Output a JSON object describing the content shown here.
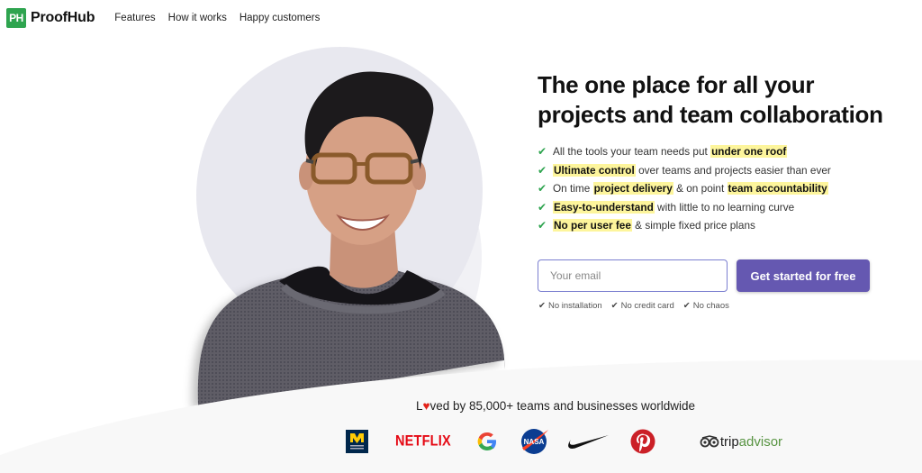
{
  "nav": {
    "logo_badge": "PH",
    "logo_text": "ProofHub",
    "links": [
      "Features",
      "How it works",
      "Happy customers"
    ]
  },
  "hero": {
    "title_line1": "The one place for all your",
    "title_line2": "projects and team collaboration",
    "features": [
      [
        {
          "t": "All the tools your team needs put ",
          "h": false
        },
        {
          "t": "under one roof",
          "h": true
        }
      ],
      [
        {
          "t": "Ultimate control",
          "h": true
        },
        {
          "t": " over teams and projects easier than ever",
          "h": false
        }
      ],
      [
        {
          "t": "On time ",
          "h": false
        },
        {
          "t": "project delivery",
          "h": true
        },
        {
          "t": " & on point ",
          "h": false
        },
        {
          "t": "team accountability",
          "h": true
        }
      ],
      [
        {
          "t": "Easy-to-understand",
          "h": true
        },
        {
          "t": " with little to no learning curve",
          "h": false
        }
      ],
      [
        {
          "t": "No per user fee",
          "h": true
        },
        {
          "t": " & simple fixed price plans",
          "h": false
        }
      ]
    ],
    "email_placeholder": "Your email",
    "email_value": "",
    "cta_label": "Get started for free",
    "perks": [
      "No installation",
      "No credit card",
      "No chaos"
    ]
  },
  "social_proof": {
    "loved_prefix": "L",
    "loved_suffix": "ved by 85,000+ teams and businesses worldwide",
    "logos": [
      "michigan-medicine",
      "netflix",
      "google",
      "nasa",
      "nike",
      "pinterest",
      "tripadvisor"
    ],
    "netflix_text": "NETFLIX",
    "trip_text": "trip",
    "advisor_text": "advisor"
  },
  "colors": {
    "brand_green": "#2ea44f",
    "cta_purple": "#6558b1",
    "highlight": "#fdf59c",
    "heart": "#e3231a"
  }
}
